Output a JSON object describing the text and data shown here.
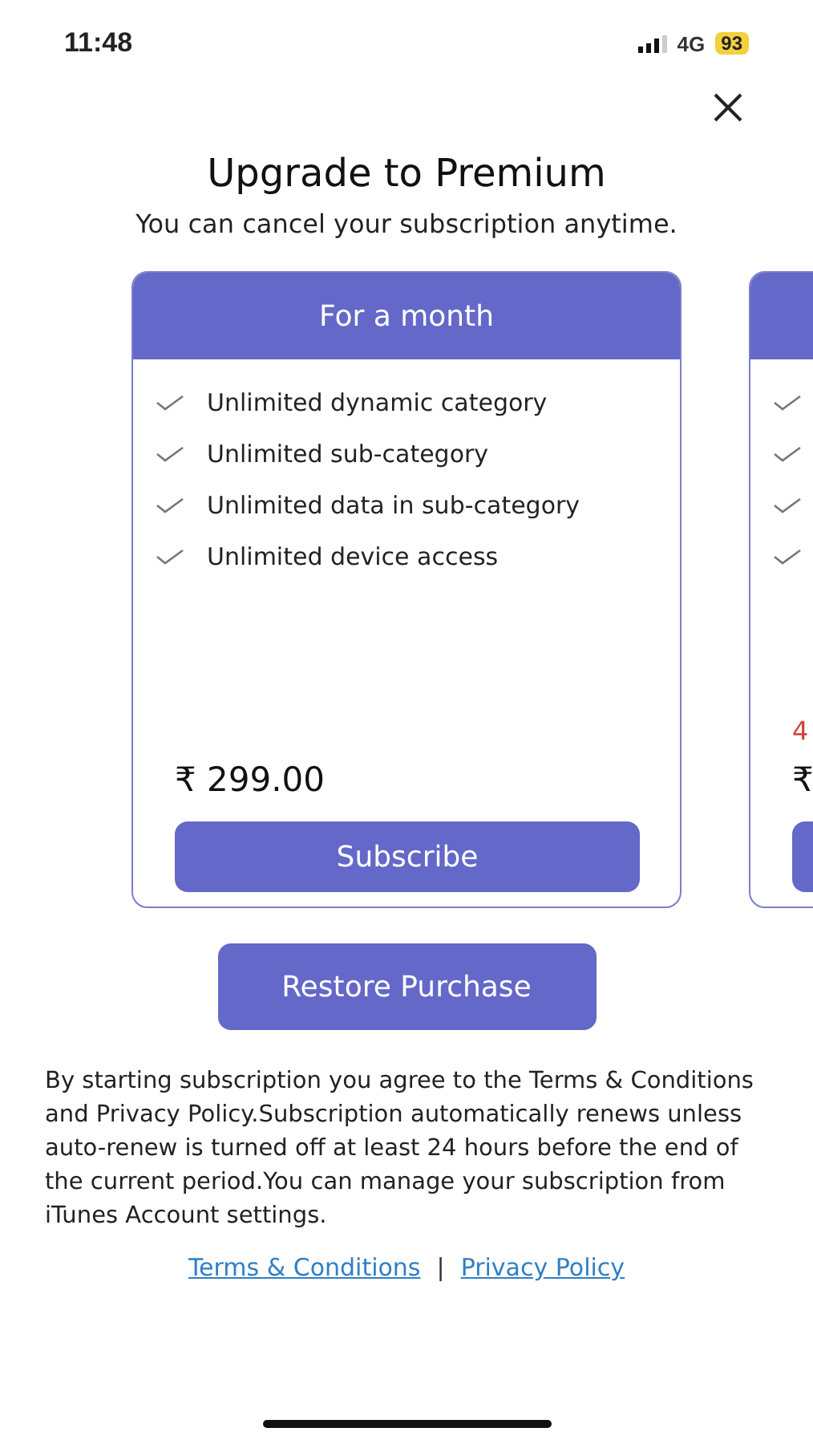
{
  "status_bar": {
    "time": "11:48",
    "network": "4G",
    "battery": "93"
  },
  "title": "Upgrade to Premium",
  "subtitle": "You can cancel your subscription anytime.",
  "plans": [
    {
      "title": "For a month",
      "features": [
        {
          "text": "Unlimited dynamic category",
          "checked": true
        },
        {
          "text": "Unlimited sub-category",
          "checked": true
        },
        {
          "text": "Unlimited data in sub-category",
          "checked": true
        },
        {
          "text": "Unlimited device access",
          "checked": true
        }
      ],
      "price": "₹ 299.00",
      "button": "Subscribe"
    },
    {
      "features": [
        {
          "checked": true
        },
        {
          "checked": true
        },
        {
          "checked": true
        },
        {
          "checked": true
        }
      ],
      "note": "4",
      "price": "₹"
    }
  ],
  "restore_button": "Restore Purchase",
  "disclaimer": "By starting subscription you agree to the Terms & Conditions and Privacy Policy.Subscription automatically renews unless auto-renew is turned off at least 24 hours before the end of the current period.You can manage your subscription from iTunes Account settings.",
  "links": [
    "Terms & Conditions",
    "Privacy Policy"
  ],
  "link_separator": "|"
}
